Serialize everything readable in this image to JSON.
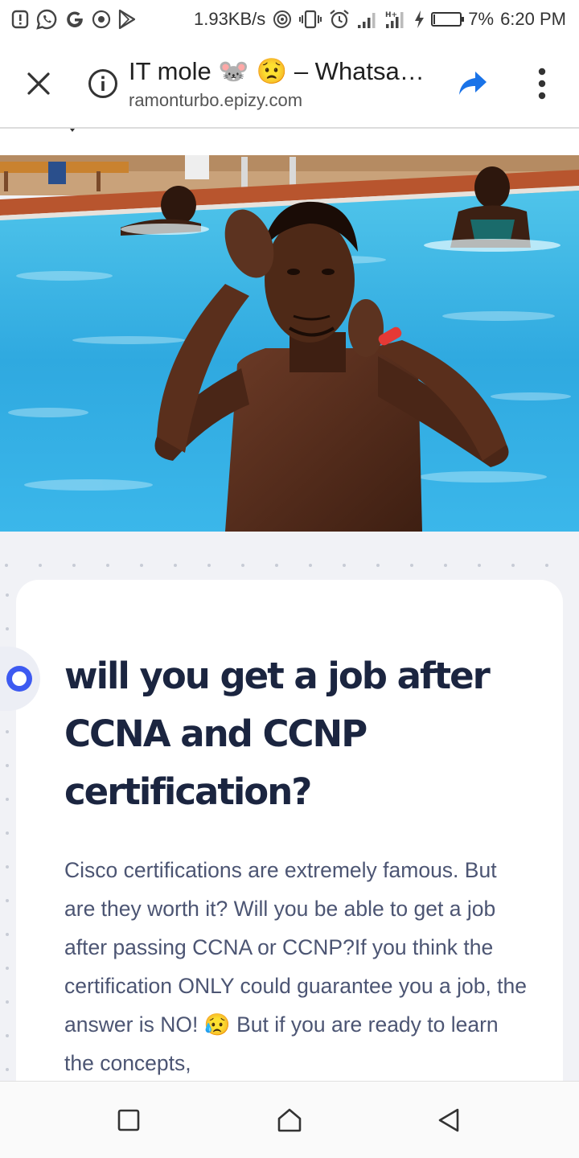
{
  "status_bar": {
    "network_speed": "1.93KB/s",
    "battery_percent": "7%",
    "battery_level": 0.07,
    "time": "6:20 PM",
    "icons": [
      "notification-alert-icon",
      "whatsapp-icon",
      "google-icon",
      "camera-icon",
      "play-store-icon",
      "hotspot-icon",
      "vibrate-icon",
      "alarm-icon",
      "signal-icon",
      "signal-h-plus-icon",
      "charging-icon",
      "battery-icon"
    ]
  },
  "toolbar": {
    "title": "IT mole 🐭 😟 – Whatsa…",
    "url": "ramonturbo.epizy.com",
    "icons": [
      "close-icon",
      "info-icon",
      "share-icon",
      "more-vert-icon"
    ],
    "accent_color": "#1a73e8"
  },
  "article": {
    "title": "will you get a job after CCNA and CCNP certification?",
    "body": "Cisco certifications are extremely famous. But are they worth it? Will you be able to get a job after passing CCNA or CCNP?If you think the certification ONLY could guarantee you a job, the answer is NO! 😥 But if you are ready to learn the concepts,",
    "title_color": "#1b2540",
    "body_color": "#4c5573",
    "timeline_color": "#3d5af1"
  },
  "navbar": {
    "icons": [
      "recents-icon",
      "home-icon",
      "back-icon"
    ]
  }
}
